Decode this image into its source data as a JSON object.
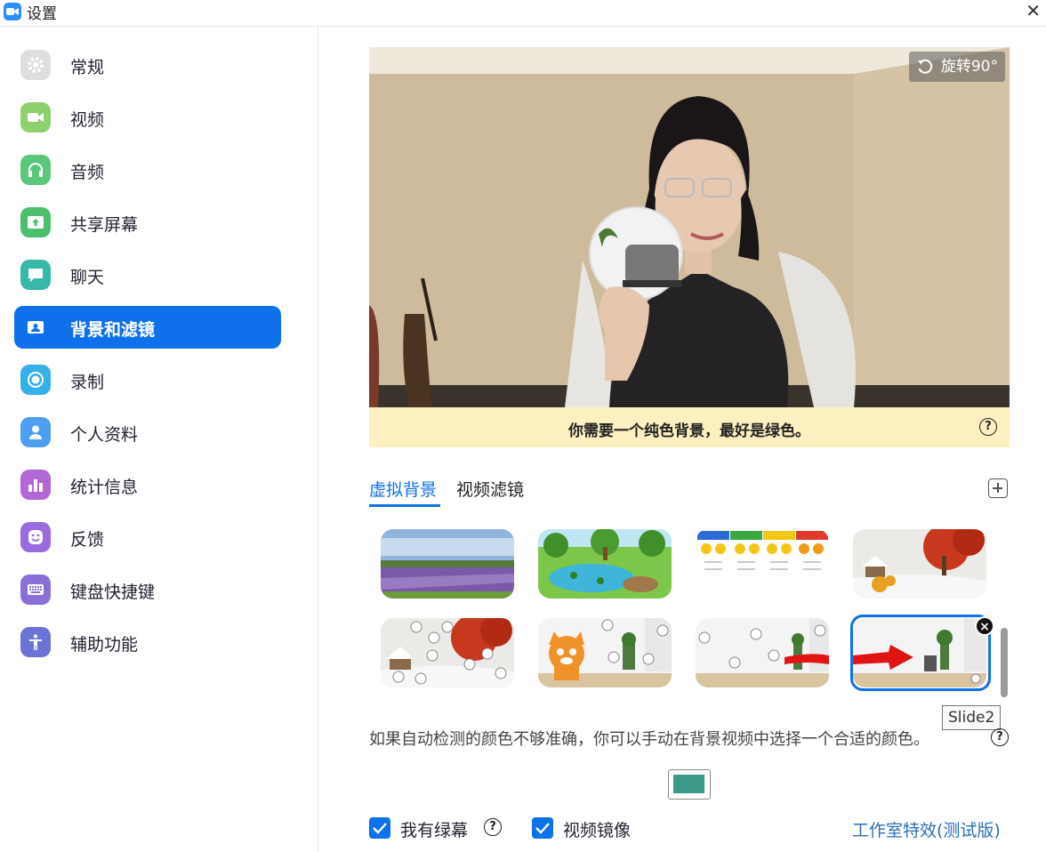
{
  "window": {
    "title": "设置",
    "close_icon": "close-icon"
  },
  "sidebar": {
    "items": [
      {
        "label": "常规",
        "icon": "gear-icon",
        "icon_color": "#d9d9d9",
        "active": false
      },
      {
        "label": "视频",
        "icon": "video-camera-icon",
        "icon_color": "#8fd06e",
        "active": false
      },
      {
        "label": "音频",
        "icon": "headphones-icon",
        "icon_color": "#5bc77a",
        "active": false
      },
      {
        "label": "共享屏幕",
        "icon": "share-screen-icon",
        "icon_color": "#4bbf6b",
        "active": false
      },
      {
        "label": "聊天",
        "icon": "chat-bubble-icon",
        "icon_color": "#37b8a8",
        "active": false
      },
      {
        "label": "背景和滤镜",
        "icon": "background-portrait-icon",
        "icon_color": "#0e71eb",
        "active": true
      },
      {
        "label": "录制",
        "icon": "record-icon",
        "icon_color": "#35b0e8",
        "active": false
      },
      {
        "label": "个人资料",
        "icon": "user-profile-icon",
        "icon_color": "#4d9ef0",
        "active": false
      },
      {
        "label": "统计信息",
        "icon": "statistics-icon",
        "icon_color": "#b267d6",
        "active": false
      },
      {
        "label": "反馈",
        "icon": "smiley-icon",
        "icon_color": "#9a6bde",
        "active": false
      },
      {
        "label": "键盘快捷键",
        "icon": "keyboard-icon",
        "icon_color": "#8a6fd8",
        "active": false
      },
      {
        "label": "辅助功能",
        "icon": "accessibility-icon",
        "icon_color": "#6b74d6",
        "active": false
      }
    ]
  },
  "preview": {
    "rotate_label": "旋转90°"
  },
  "warning": {
    "text": "你需要一个纯色背景，最好是绿色。"
  },
  "tabs": [
    {
      "label": "虚拟背景",
      "active": true
    },
    {
      "label": "视频滤镜",
      "active": false
    }
  ],
  "backgrounds": [
    {
      "name": "lavender-field"
    },
    {
      "name": "cartoon-pond"
    },
    {
      "name": "emoji-chart"
    },
    {
      "name": "winter-tree"
    },
    {
      "name": "winter-tree-icons"
    },
    {
      "name": "cat-room"
    },
    {
      "name": "room-arrow"
    },
    {
      "name": "room-slide2",
      "selected": true
    }
  ],
  "tooltip": "Slide2",
  "hint": "如果自动检测的颜色不够准确，你可以手动在背景视频中选择一个合适的颜色。",
  "key_color": "#3a9a87",
  "options": {
    "green_screen_label": "我有绿幕",
    "mirror_label": "视频镜像",
    "green_screen_checked": true,
    "mirror_checked": true
  },
  "studio_effects_link": "工作室特效(测试版)"
}
